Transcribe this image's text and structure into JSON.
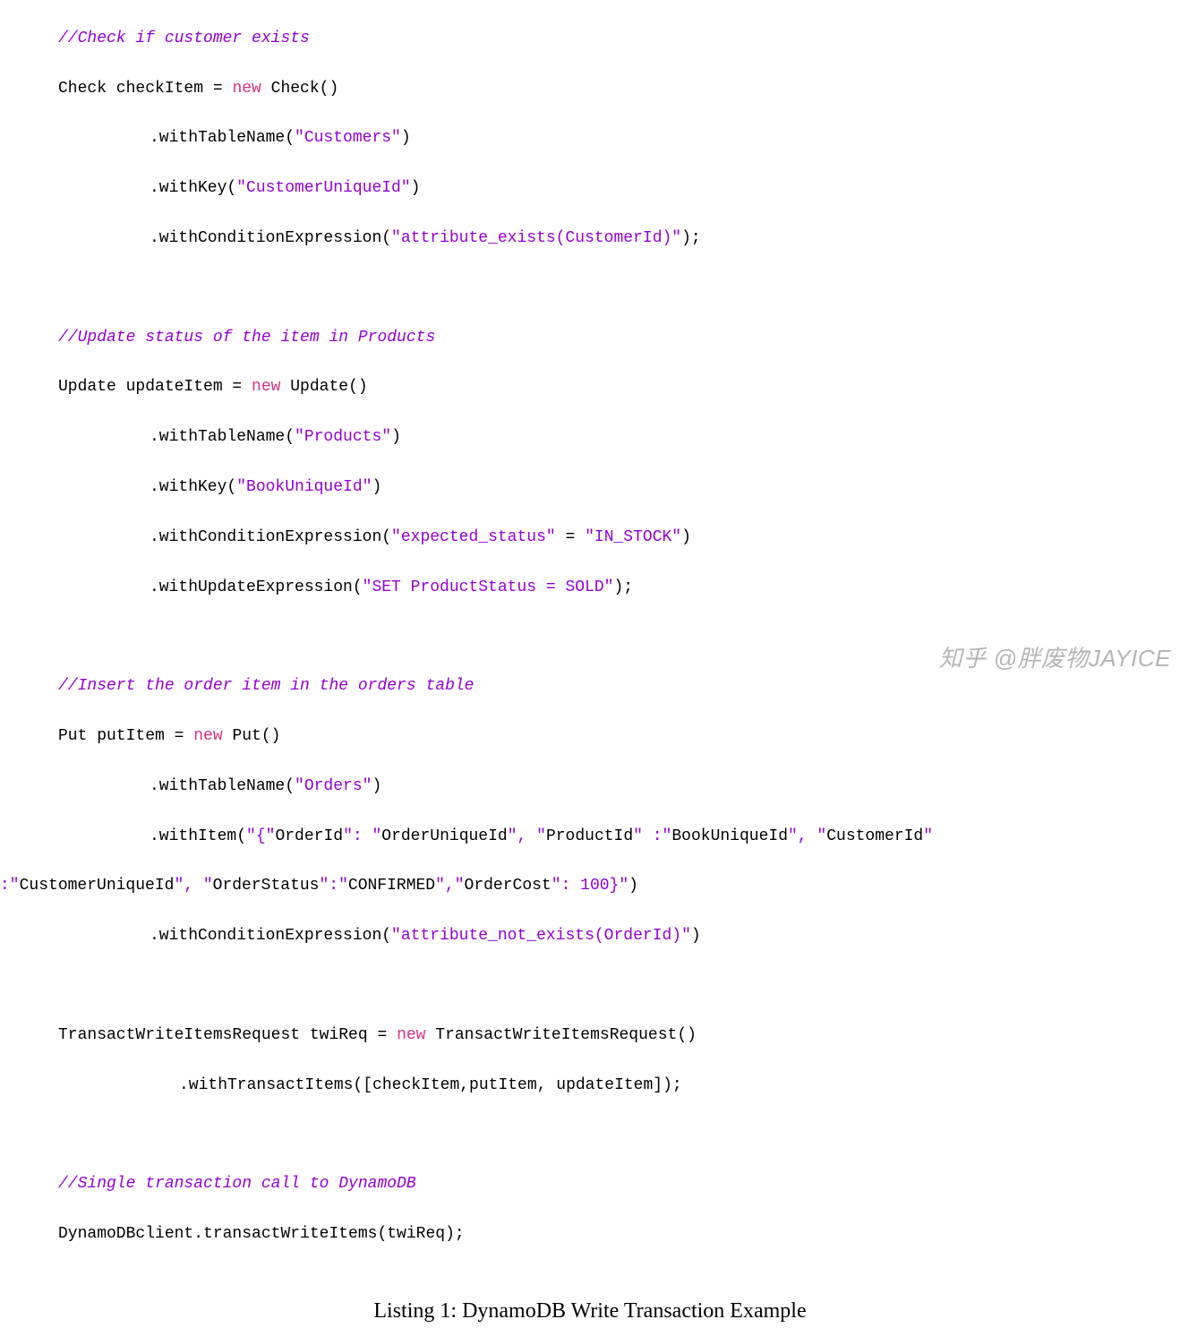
{
  "code": {
    "l1": "//Check if customer exists",
    "l2a": "Check checkItem = ",
    "l2b": "new",
    "l2c": " Check()",
    "l3a": ".withTableName(",
    "l3b": "\"Customers\"",
    "l3c": ")",
    "l4a": ".withKey(",
    "l4b": "\"CustomerUniqueId\"",
    "l4c": ")",
    "l5a": ".withConditionExpression(",
    "l5b": "\"attribute_exists(CustomerId)\"",
    "l5c": ");",
    "l6": "//Update status of the item in Products",
    "l7a": "Update updateItem = ",
    "l7b": "new",
    "l7c": " Update()",
    "l8a": ".withTableName(",
    "l8b": "\"Products\"",
    "l8c": ")",
    "l9a": ".withKey(",
    "l9b": "\"BookUniqueId\"",
    "l9c": ")",
    "l10a": ".withConditionExpression(",
    "l10b": "\"expected_status\"",
    "l10c": " = ",
    "l10d": "\"IN_STOCK\"",
    "l10e": ")",
    "l11a": ".withUpdateExpression(",
    "l11b": "\"SET ProductStatus = SOLD\"",
    "l11c": ");",
    "l12": "//Insert the order item in the orders table",
    "l13a": "Put putItem = ",
    "l13b": "new",
    "l13c": " Put()",
    "l14a": ".withTableName(",
    "l14b": "\"Orders\"",
    "l14c": ")",
    "l15a": ".withItem(",
    "l15b": "\"{\"",
    "l15c": "OrderId",
    "l15d": "\": \"",
    "l15e": "OrderUniqueId",
    "l15f": "\", \"",
    "l15g": "ProductId",
    "l15h": "\" :\"",
    "l15i": "BookUniqueId",
    "l15j": "\", \"",
    "l15k": "CustomerId",
    "l15l": "\"",
    "l16a": ":\"",
    "l16b": "CustomerUniqueId",
    "l16c": "\", \"",
    "l16d": "OrderStatus",
    "l16e": "\":\"",
    "l16f": "CONFIRMED",
    "l16g": "\",\"",
    "l16h": "OrderCost",
    "l16i": "\": 100}\"",
    "l16j": ")",
    "l17a": ".withConditionExpression(",
    "l17b": "\"attribute_not_exists(OrderId)\"",
    "l17c": ")",
    "l18a": "TransactWriteItemsRequest twiReq = ",
    "l18b": "new",
    "l18c": " TransactWriteItemsRequest()",
    "l19a": ".withTransactItems([checkItem,putItem, updateItem]);",
    "l20": "//Single transaction call to DynamoDB",
    "l21": "DynamoDBclient.transactWriteItems(twiReq);"
  },
  "caption": "Listing 1: DynamoDB Write Transaction Example",
  "watermark": "知乎 @胖废物JAYICE"
}
